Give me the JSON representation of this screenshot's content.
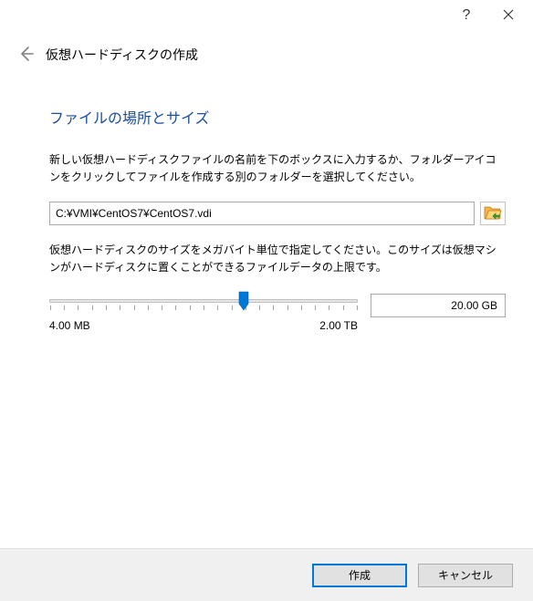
{
  "titlebar": {
    "help_symbol": "?"
  },
  "header": {
    "title": "仮想ハードディスクの作成"
  },
  "section": {
    "title": "ファイルの場所とサイズ",
    "desc1": "新しい仮想ハードディスクファイルの名前を下のボックスに入力するか、フォルダーアイコンをクリックしてファイルを作成する別のフォルダーを選択してください。",
    "desc2": "仮想ハードディスクのサイズをメガバイト単位で指定してください。このサイズは仮想マシンがハードディスクに置くことができるファイルデータの上限です。"
  },
  "file": {
    "path": "C:¥VMI¥CentOS7¥CentOS7.vdi"
  },
  "slider": {
    "min_label": "4.00 MB",
    "max_label": "2.00 TB",
    "value_display": "20.00 GB",
    "thumb_percent": 63
  },
  "buttons": {
    "create": "作成",
    "cancel": "キャンセル"
  }
}
